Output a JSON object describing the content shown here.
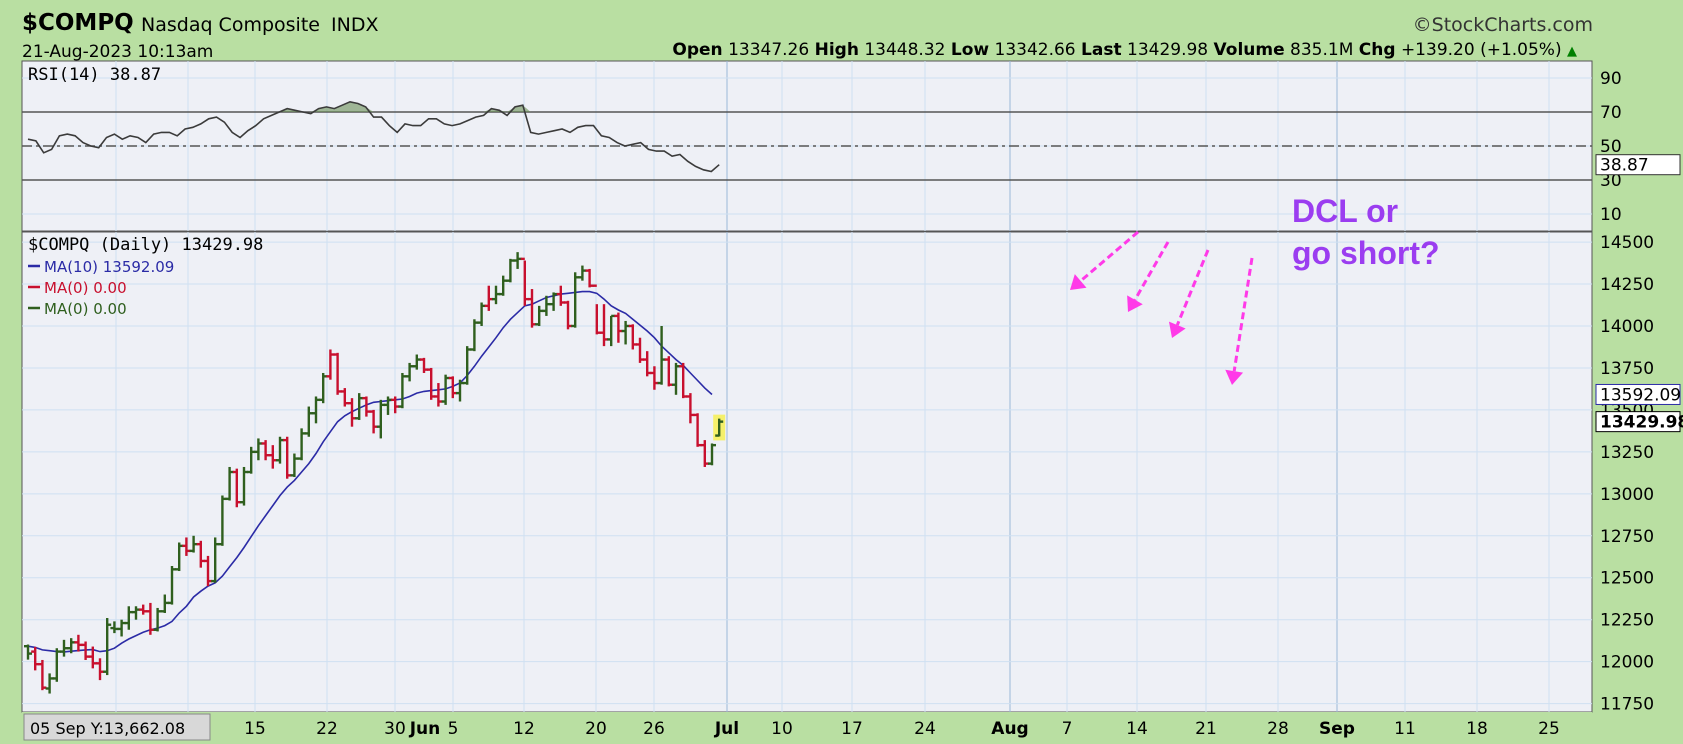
{
  "header": {
    "symbol": "$COMPQ",
    "name": "Nasdaq Composite",
    "exchange": "INDX",
    "brand": "©StockCharts.com",
    "datetime": "21-Aug-2023 10:13am",
    "open_label": "Open",
    "open": "13347.26",
    "high_label": "High",
    "high": "13448.32",
    "low_label": "Low",
    "low": "13342.66",
    "last_label": "Last",
    "last": "13429.98",
    "volume_label": "Volume",
    "volume": "835.1M",
    "chg_label": "Chg",
    "chg": "+139.20 (+1.05%)"
  },
  "annotation": {
    "line1": "DCL or",
    "line2": "go short?"
  },
  "colors": {
    "background": "#b9dfa2",
    "panel": "#eef0f6",
    "up": "#2f5f1e",
    "down": "#c8102e",
    "ma": "#2b2ba6",
    "annotation": "#9b3df0",
    "arrows": "#ff3ae8"
  },
  "chart_data": [
    {
      "type": "line",
      "title": "RSI(14) 38.87",
      "ylim": [
        0,
        100
      ],
      "yticks": [
        90,
        70,
        50,
        30,
        10
      ],
      "reference_lines": [
        70,
        50,
        30
      ],
      "last_label": "38.87",
      "series": [
        {
          "name": "RSI(14)",
          "values": [
            54,
            53,
            46,
            48,
            56,
            57,
            56,
            52,
            50,
            49,
            55,
            57,
            54,
            56,
            55,
            52,
            57,
            58,
            58,
            56,
            60,
            61,
            63,
            66,
            67,
            64,
            58,
            55,
            59,
            62,
            66,
            68,
            70,
            72,
            71,
            70,
            69,
            72,
            73,
            72,
            74,
            76,
            75,
            73,
            67,
            67,
            62,
            58,
            63,
            62,
            62,
            66,
            66,
            63,
            62,
            63,
            65,
            67,
            68,
            72,
            71,
            68,
            73,
            74,
            58,
            57,
            58,
            59,
            60,
            58,
            61,
            62,
            62,
            56,
            55,
            52,
            50,
            51,
            52,
            48,
            47,
            47,
            44,
            45,
            41,
            38,
            36,
            35,
            39
          ]
        }
      ]
    },
    {
      "type": "ohlc",
      "title": "$COMPQ (Daily) 13429.98",
      "ylim": [
        11700,
        14560
      ],
      "yticks": [
        14500,
        14250,
        14000,
        13750,
        13500,
        13250,
        13000,
        12750,
        12500,
        12250,
        12000,
        11750
      ],
      "x_labels": [
        "15",
        "22",
        "30",
        "Jun",
        "5",
        "12",
        "20",
        "26",
        "Jul",
        "10",
        "17",
        "24",
        "Aug",
        "7",
        "14",
        "21",
        "28",
        "Sep",
        "11",
        "18",
        "25"
      ],
      "overview_label": "05 Sep Y:13,662.08",
      "price_label": "13429.98",
      "ma_label": "13592.09",
      "legend": [
        {
          "name": "MA(10) 13592.09",
          "color": "#2b2ba6"
        },
        {
          "name": "MA(0) 0.00",
          "color": "#c8102e"
        },
        {
          "name": "MA(0) 0.00",
          "color": "#2f5f1e"
        }
      ],
      "bars": [
        [
          12092,
          12102,
          12012,
          12048,
          1
        ],
        [
          12060,
          12088,
          11948,
          11985,
          0
        ],
        [
          11985,
          12010,
          11830,
          11845,
          0
        ],
        [
          11840,
          11930,
          11810,
          11900,
          1
        ],
        [
          11900,
          12080,
          11880,
          12060,
          1
        ],
        [
          12060,
          12130,
          12030,
          12080,
          1
        ],
        [
          12080,
          12140,
          12050,
          12115,
          1
        ],
        [
          12115,
          12160,
          12060,
          12100,
          0
        ],
        [
          12100,
          12120,
          12010,
          12030,
          0
        ],
        [
          12030,
          12090,
          11960,
          11990,
          0
        ],
        [
          11990,
          12020,
          11890,
          11940,
          0
        ],
        [
          11940,
          12260,
          11920,
          12220,
          1
        ],
        [
          12200,
          12240,
          12170,
          12195,
          1
        ],
        [
          12195,
          12250,
          12150,
          12230,
          1
        ],
        [
          12230,
          12330,
          12190,
          12295,
          1
        ],
        [
          12295,
          12330,
          12250,
          12310,
          1
        ],
        [
          12310,
          12340,
          12280,
          12300,
          0
        ],
        [
          12300,
          12350,
          12160,
          12190,
          0
        ],
        [
          12190,
          12320,
          12180,
          12300,
          1
        ],
        [
          12300,
          12400,
          12290,
          12350,
          1
        ],
        [
          12350,
          12570,
          12340,
          12550,
          1
        ],
        [
          12550,
          12710,
          12540,
          12690,
          1
        ],
        [
          12690,
          12740,
          12630,
          12660,
          0
        ],
        [
          12660,
          12750,
          12650,
          12700,
          1
        ],
        [
          12700,
          12720,
          12560,
          12600,
          0
        ],
        [
          12600,
          12630,
          12450,
          12480,
          0
        ],
        [
          12480,
          12740,
          12470,
          12700,
          1
        ],
        [
          12700,
          12990,
          12690,
          12970,
          1
        ],
        [
          12970,
          13160,
          12960,
          13130,
          1
        ],
        [
          13130,
          13150,
          12920,
          12950,
          0
        ],
        [
          12950,
          13160,
          12930,
          13130,
          1
        ],
        [
          13130,
          13280,
          13120,
          13250,
          1
        ],
        [
          13250,
          13330,
          13200,
          13300,
          1
        ],
        [
          13300,
          13320,
          13200,
          13230,
          0
        ],
        [
          13230,
          13290,
          13150,
          13200,
          0
        ],
        [
          13200,
          13340,
          13180,
          13320,
          1
        ],
        [
          13320,
          13340,
          13090,
          13110,
          0
        ],
        [
          13110,
          13240,
          13100,
          13210,
          1
        ],
        [
          13210,
          13390,
          13200,
          13360,
          1
        ],
        [
          13360,
          13520,
          13340,
          13480,
          1
        ],
        [
          13480,
          13580,
          13420,
          13560,
          1
        ],
        [
          13560,
          13720,
          13540,
          13700,
          1
        ],
        [
          13700,
          13860,
          13680,
          13830,
          0
        ],
        [
          13830,
          13840,
          13590,
          13610,
          0
        ],
        [
          13610,
          13630,
          13520,
          13540,
          0
        ],
        [
          13540,
          13570,
          13400,
          13450,
          0
        ],
        [
          13450,
          13600,
          13440,
          13570,
          1
        ],
        [
          13570,
          13580,
          13460,
          13490,
          0
        ],
        [
          13490,
          13500,
          13360,
          13400,
          0
        ],
        [
          13400,
          13560,
          13330,
          13530,
          1
        ],
        [
          13530,
          13580,
          13470,
          13560,
          1
        ],
        [
          13560,
          13580,
          13480,
          13520,
          0
        ],
        [
          13520,
          13720,
          13510,
          13700,
          1
        ],
        [
          13700,
          13780,
          13670,
          13760,
          1
        ],
        [
          13760,
          13830,
          13740,
          13800,
          1
        ],
        [
          13800,
          13810,
          13720,
          13740,
          0
        ],
        [
          13740,
          13750,
          13560,
          13580,
          0
        ],
        [
          13580,
          13660,
          13520,
          13550,
          0
        ],
        [
          13550,
          13710,
          13530,
          13690,
          1
        ],
        [
          13690,
          13700,
          13570,
          13600,
          0
        ],
        [
          13600,
          13680,
          13550,
          13660,
          1
        ],
        [
          13660,
          13880,
          13650,
          13860,
          1
        ],
        [
          13860,
          14040,
          13850,
          14020,
          1
        ],
        [
          14020,
          14140,
          14000,
          14120,
          1
        ],
        [
          14120,
          14240,
          14090,
          14160,
          0
        ],
        [
          14160,
          14240,
          14130,
          14190,
          1
        ],
        [
          14190,
          14300,
          14180,
          14270,
          1
        ],
        [
          14270,
          14400,
          14260,
          14390,
          1
        ],
        [
          14390,
          14440,
          14340,
          14400,
          1
        ],
        [
          14400,
          14390,
          14120,
          14160,
          0
        ],
        [
          14160,
          14220,
          13990,
          14010,
          0
        ],
        [
          14010,
          14120,
          14000,
          14090,
          1
        ],
        [
          14090,
          14180,
          14060,
          14130,
          1
        ],
        [
          14130,
          14200,
          14090,
          14190,
          1
        ],
        [
          14190,
          14240,
          14120,
          14140,
          0
        ],
        [
          14140,
          14150,
          13980,
          14000,
          0
        ],
        [
          14000,
          14320,
          13990,
          14290,
          1
        ],
        [
          14290,
          14360,
          14270,
          14330,
          1
        ],
        [
          14330,
          14340,
          14230,
          14240,
          0
        ],
        [
          14240,
          14130,
          13950,
          13960,
          0
        ],
        [
          13960,
          14130,
          13880,
          13920,
          0
        ],
        [
          13920,
          14060,
          13880,
          14060,
          1
        ],
        [
          14060,
          14080,
          13900,
          13970,
          0
        ],
        [
          13970,
          14030,
          13890,
          14000,
          1
        ],
        [
          14000,
          14010,
          13860,
          13890,
          0
        ],
        [
          13890,
          13930,
          13780,
          13800,
          0
        ],
        [
          13800,
          13850,
          13700,
          13720,
          0
        ],
        [
          13720,
          13760,
          13620,
          13660,
          0
        ],
        [
          13660,
          14000,
          13650,
          13800,
          1
        ],
        [
          13800,
          13820,
          13640,
          13650,
          0
        ],
        [
          13650,
          13780,
          13590,
          13760,
          1
        ],
        [
          13760,
          13780,
          13570,
          13580,
          0
        ],
        [
          13580,
          13600,
          13420,
          13470,
          0
        ],
        [
          13470,
          13480,
          13280,
          13290,
          0
        ],
        [
          13290,
          13320,
          13160,
          13180,
          0
        ],
        [
          13180,
          13300,
          13170,
          13290,
          1
        ],
        [
          13347,
          13448,
          13342,
          13430,
          1
        ]
      ],
      "ma10": [
        12092,
        12085,
        12070,
        12065,
        12060,
        12058,
        12062,
        12066,
        12070,
        12072,
        12060,
        12065,
        12080,
        12110,
        12135,
        12155,
        12175,
        12190,
        12200,
        12215,
        12240,
        12290,
        12330,
        12385,
        12420,
        12450,
        12470,
        12510,
        12565,
        12620,
        12680,
        12745,
        12810,
        12870,
        12930,
        12990,
        13040,
        13080,
        13130,
        13180,
        13240,
        13310,
        13370,
        13430,
        13465,
        13490,
        13510,
        13530,
        13545,
        13550,
        13555,
        13560,
        13565,
        13580,
        13600,
        13610,
        13615,
        13620,
        13625,
        13640,
        13660,
        13705,
        13760,
        13820,
        13875,
        13930,
        13990,
        14040,
        14080,
        14120,
        14130,
        14150,
        14170,
        14180,
        14190,
        14195,
        14200,
        14205,
        14205,
        14195,
        14160,
        14120,
        14095,
        14075,
        14040,
        14005,
        13970,
        13930,
        13880,
        13840,
        13800,
        13765,
        13720,
        13675,
        13630,
        13592
      ]
    }
  ]
}
